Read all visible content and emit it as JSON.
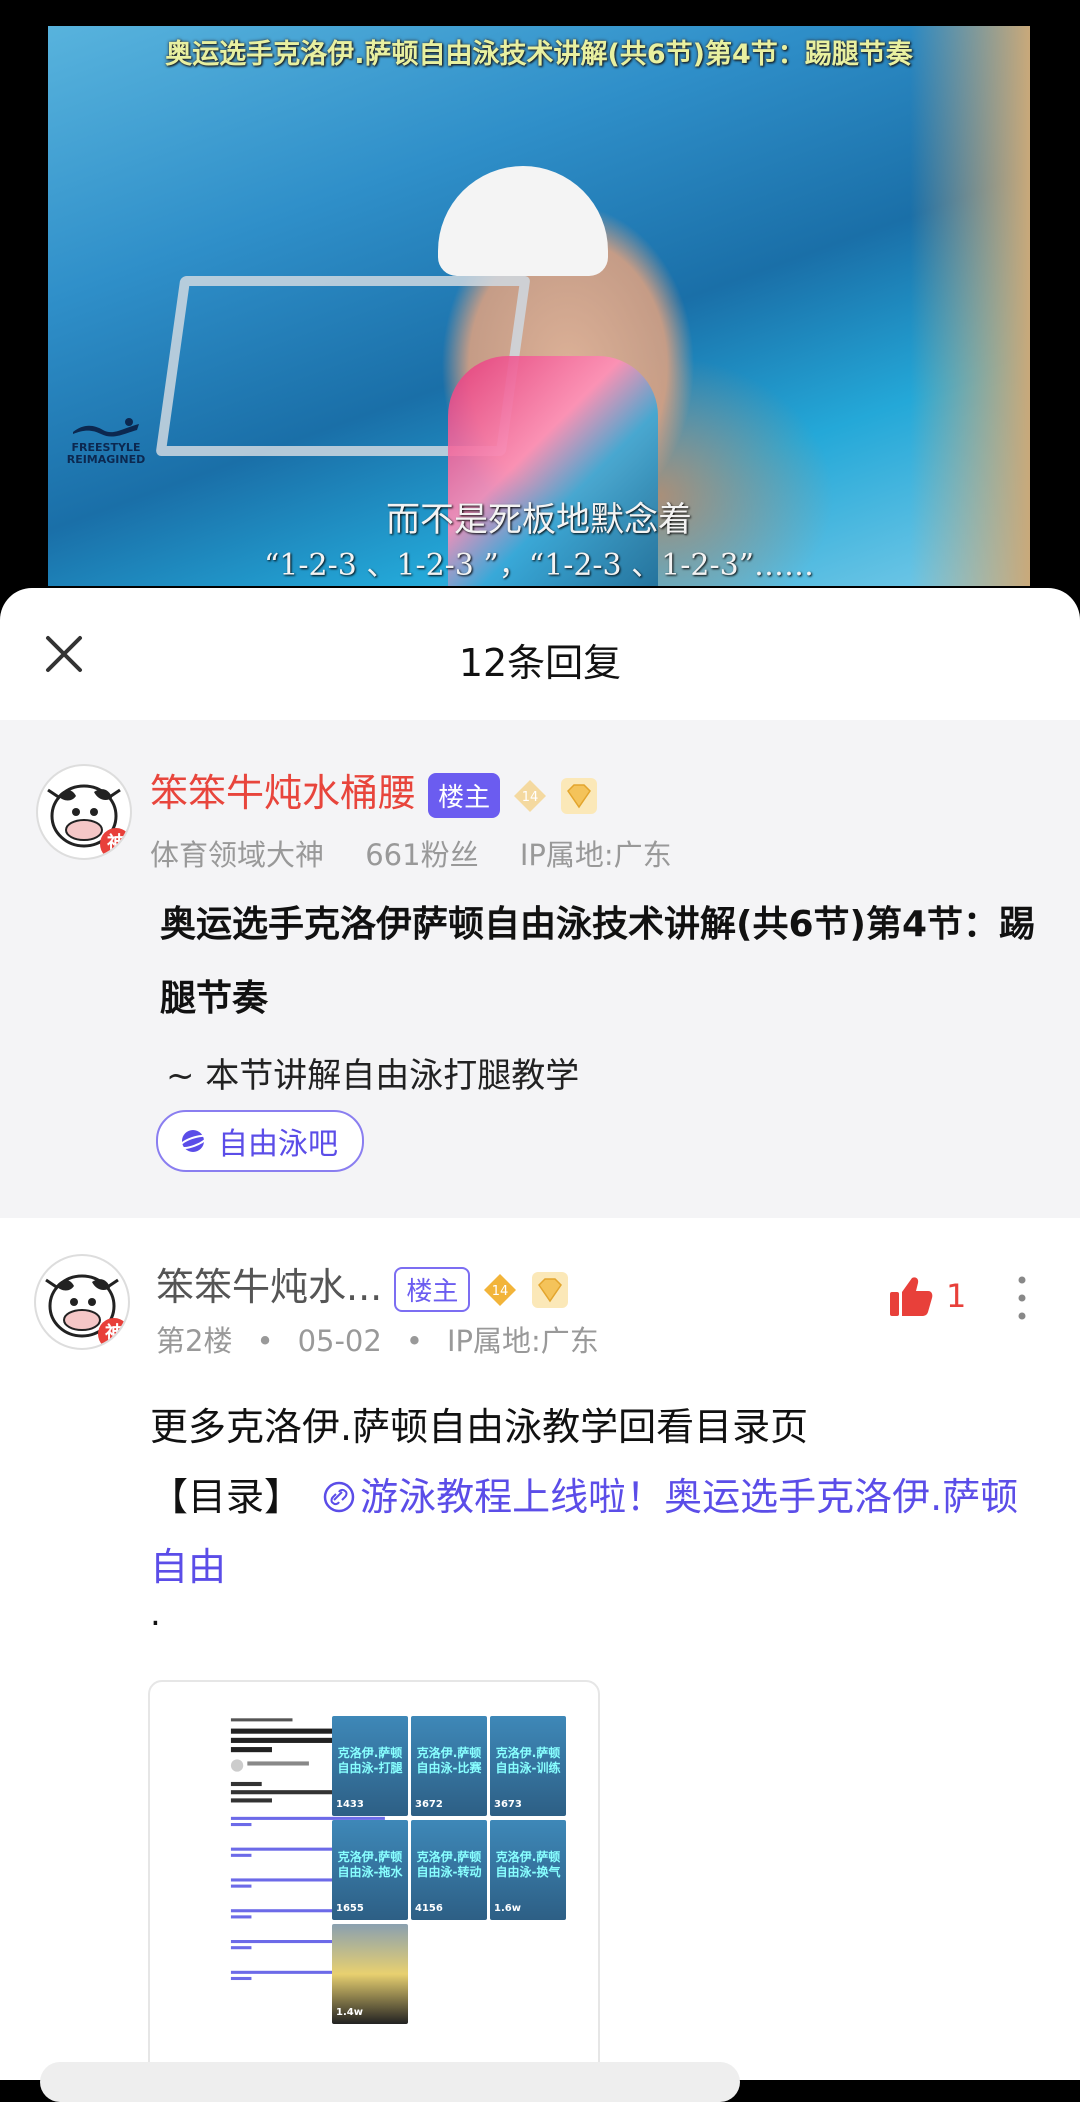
{
  "video": {
    "title": "奥运选手克洛伊.萨顿自由泳技术讲解(共6节)第4节：踢腿节奏",
    "logo_text": "FREESTYLE REIMAGINED",
    "subtitle_line1": "而不是死板地默念着",
    "subtitle_line2": "“1-2-3 、1-2-3 ”，“1-2-3 、1-2-3”……"
  },
  "sheet": {
    "title": "12条回复",
    "close_icon": "close-icon"
  },
  "original_post": {
    "author": "笨笨牛炖水桶腰",
    "host_tag": "楼主",
    "level": "14",
    "avatar_badge": "神",
    "meta": {
      "rank": "体育领域大神",
      "fans": "661粉丝",
      "ip": "IP属地:广东"
    },
    "title": "奥运选手克洛伊萨顿自由泳技术讲解(共6节)第4节：踢腿节奏",
    "desc": "~ 本节讲解自由泳打腿教学",
    "forum": "自由泳吧"
  },
  "reply": {
    "author": "笨笨牛炖水...",
    "host_tag": "楼主",
    "level": "14",
    "avatar_badge": "神",
    "floor": "第2楼",
    "date": "05-02",
    "ip": "IP属地:广东",
    "likes": "1",
    "text_line1": "更多克洛伊.萨顿自由泳教学回看目录页",
    "text_prefix": "【目录】",
    "link_text": "游泳教程上线啦！奥运选手克洛伊.萨顿自由",
    "dot": ".",
    "thumb_cells": [
      {
        "label": "克洛伊.萨顿\n自由泳-打腿",
        "plays": "1433"
      },
      {
        "label": "克洛伊.萨顿\n自由泳-比赛",
        "plays": "3672"
      },
      {
        "label": "克洛伊.萨顿\n自由泳-训练",
        "plays": "3673"
      },
      {
        "label": "克洛伊.萨顿\n自由泳-拖水",
        "plays": "1655"
      },
      {
        "label": "克洛伊.萨顿\n自由泳-转动",
        "plays": "4156"
      },
      {
        "label": "克洛伊.萨顿\n自由泳-换气",
        "plays": "1.6w"
      },
      {
        "label": "",
        "plays": "1.4w"
      }
    ]
  },
  "colors": {
    "accent": "#5b4de8",
    "op_name": "#e8453c",
    "like": "#e8403a"
  }
}
